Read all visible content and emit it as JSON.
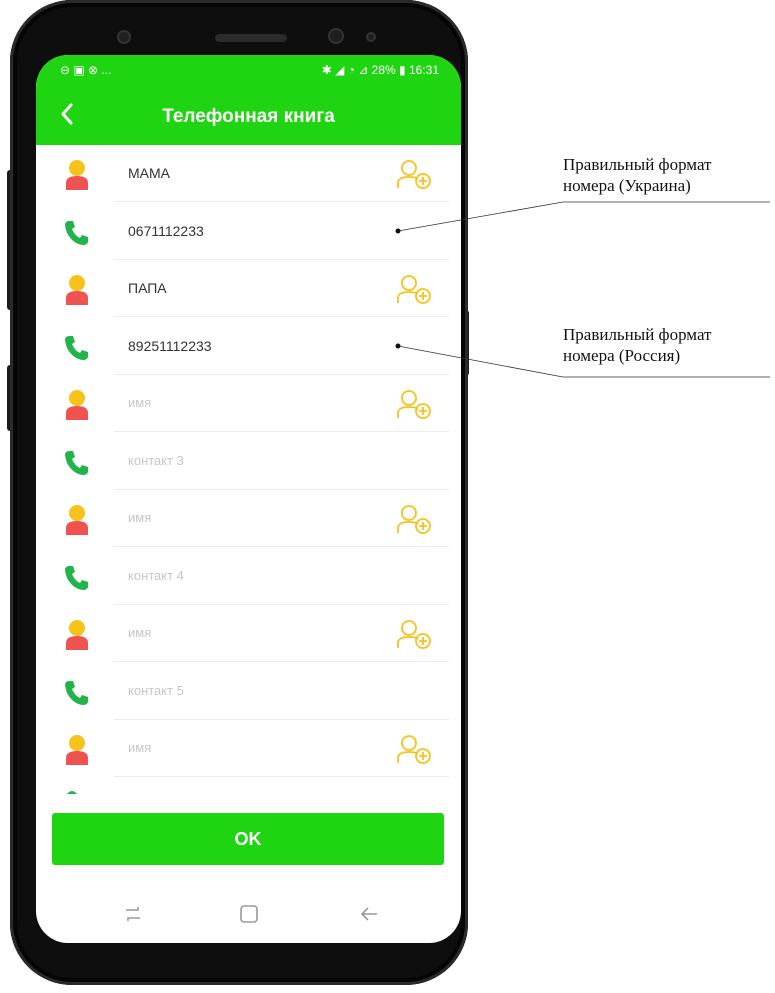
{
  "status_bar": {
    "left_icons": "⊖ ▣ ⊗ ...",
    "right_text": "✱ ◢ ◔ ⊿ 28% ▮ 16:31"
  },
  "header": {
    "back_icon": "chevron-left-icon",
    "title": "Телефонная книга"
  },
  "contacts": [
    {
      "name": "МАМА",
      "name_is_placeholder": false,
      "phone": "0671112233",
      "phone_is_placeholder": false
    },
    {
      "name": "ПАПА",
      "name_is_placeholder": false,
      "phone": "89251112233",
      "phone_is_placeholder": false
    },
    {
      "name": "имя",
      "name_is_placeholder": true,
      "phone": "контакт 3",
      "phone_is_placeholder": true
    },
    {
      "name": "имя",
      "name_is_placeholder": true,
      "phone": "контакт 4",
      "phone_is_placeholder": true
    },
    {
      "name": "имя",
      "name_is_placeholder": true,
      "phone": "контакт 5",
      "phone_is_placeholder": true
    },
    {
      "name": "имя",
      "name_is_placeholder": true
    }
  ],
  "ok_button": {
    "label": "OK"
  },
  "nav_bar": {
    "icons": [
      "recent-apps-icon",
      "home-icon",
      "back-arrow-icon"
    ]
  },
  "annotations": [
    {
      "line1": "Правильный формат",
      "line2": "номера (Украина)"
    },
    {
      "line1": "Правильный формат",
      "line2": "номера (Россия)"
    }
  ],
  "colors": {
    "accent_green": "#1fd512",
    "phone_icon_green": "#22b34a",
    "avatar_head": "#f7c21a",
    "avatar_body": "#ef5350",
    "add_contact_icon": "#f7c21a"
  }
}
